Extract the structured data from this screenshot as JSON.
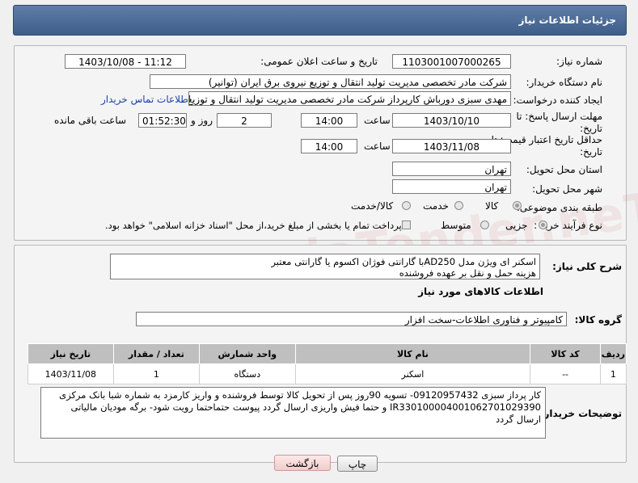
{
  "header": {
    "title": "جزئیات اطلاعات نیاز"
  },
  "form": {
    "need_number_label": "شماره نیاز:",
    "need_number": "1103001007000265",
    "announce_label": "تاریخ و ساعت اعلان عمومی:",
    "announce_value": "1403/10/08 - 11:12",
    "buyer_org_label": "نام دستگاه خریدار:",
    "buyer_org": "شرکت مادر تخصصی مدیریت تولید  انتقال و توزیع نیروی برق ایران (توانیر)",
    "creator_label": "ایجاد کننده درخواست:",
    "creator": "مهدی سبزی دورباش کارپرداز شرکت مادر تخصصی مدیریت تولید  انتقال و توزیع نیروی برق ایران",
    "contact_link": "اطلاعات تماس خریدار",
    "deadline_label": "مهلت ارسال پاسخ: تا تاریخ:",
    "deadline_date": "1403/10/10",
    "time_label": "ساعت",
    "deadline_time": "14:00",
    "days_value": "2",
    "days_label": "روز و",
    "remaining_time": "01:52:30",
    "remaining_label": "ساعت باقی مانده",
    "validity_label": "حداقل تاریخ اعتبار قیمت: تا تاریخ:",
    "validity_date": "1403/11/08",
    "validity_time": "14:00",
    "province_label": "استان محل تحویل:",
    "province": "تهران",
    "city_label": "شهر محل تحویل:",
    "city": "تهران",
    "category_label": "طبقه بندی موضوعی:",
    "category_options": [
      "کالا",
      "خدمت",
      "کالا/خدمت"
    ],
    "process_label": "نوع فرآیند خرید :",
    "process_options": [
      "جزیی",
      "متوسط"
    ],
    "payment_note": "پرداخت تمام یا بخشی از مبلغ خرید،از محل \"اسناد خزانه اسلامی\" خواهد بود."
  },
  "description": {
    "label": "شرح کلی نیاز:",
    "line1": "اسکنر  ای ویژن مدل AD250با گارانتی فوژان اکسوم یا گارانتی معتبر",
    "line2": "هزینه حمل و نقل بر عهده فروشنده"
  },
  "goods_section": {
    "title": "اطلاعات کالاهای مورد نیاز",
    "group_label": "گروه کالا:",
    "group_value": "کامپیوتر و فناوری اطلاعات-سخت افزار"
  },
  "table": {
    "headers": [
      "ردیف",
      "کد کالا",
      "نام کالا",
      "واحد شمارش",
      "تعداد / مقدار",
      "تاریخ نیاز"
    ],
    "rows": [
      [
        "1",
        "--",
        "اسکنر",
        "دستگاه",
        "1",
        "1403/11/08"
      ]
    ]
  },
  "buyer_notes": {
    "label": "توضیحات خریدار:",
    "text": "کار پرداز سبزی 09120957432- تسویه 90روز پس از تحویل کالا توسط فروشنده و واریز کارمزد به شماره شبا بانک مرکزی IR330100004001062701029390 و حتما فیش واریزی ارسال گردد پیوست حتماحتما رویت شود- برگه مودیان مالیاتی ارسال گردد"
  },
  "buttons": {
    "print": "چاپ",
    "back": "بازگشت"
  },
  "watermark": "AriaTender.neT"
}
